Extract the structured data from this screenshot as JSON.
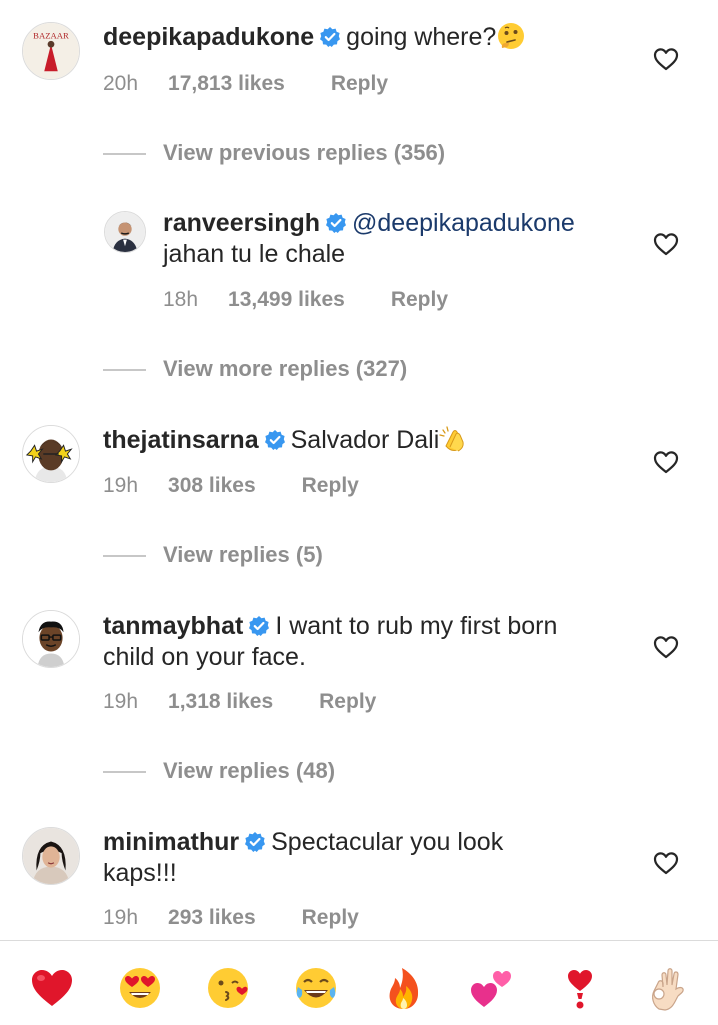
{
  "comments": [
    {
      "username": "deepikapadukone",
      "text": "going where?",
      "time": "20h",
      "likes": "17,813 likes",
      "reply": "Reply",
      "trailing_emoji": "thinking-face-emoji"
    },
    {
      "username": "ranveersingh",
      "mention": "@deepikapadukone",
      "text": "jahan tu le chale",
      "time": "18h",
      "likes": "13,499 likes",
      "reply": "Reply"
    },
    {
      "username": "thejatinsarna",
      "text": "Salvador Dali",
      "time": "19h",
      "likes": "308 likes",
      "reply": "Reply",
      "trailing_emoji": "clapping-hands-emoji"
    },
    {
      "username": "tanmaybhat",
      "text_line1": "I want to rub my first born",
      "text_line2": "child on your face.",
      "time": "19h",
      "likes": "1,318 likes",
      "reply": "Reply"
    },
    {
      "username": "minimathur",
      "text_line1": "Spectacular you look",
      "text_line2": "kaps!!!",
      "time": "19h",
      "likes": "293 likes",
      "reply": "Reply"
    }
  ],
  "view_links": {
    "previous_replies": "View previous replies (356)",
    "more_replies": "View more replies (327)",
    "replies_jatin": "View replies (5)",
    "replies_tanmay": "View replies (48)"
  },
  "avatar_texts": {
    "deepika_magazine": "BAZAAR"
  },
  "emoji_bar": [
    "red-heart",
    "heart-eyes",
    "kissing-face",
    "tears-of-joy",
    "fire",
    "two-hearts",
    "exclamation-heart",
    "ok-hand"
  ],
  "colors": {
    "username": "#262626",
    "meta": "#8e8e8e",
    "verified": "#3897f0",
    "mention": "#1b3a6b",
    "divider": "#dbdbdb"
  }
}
